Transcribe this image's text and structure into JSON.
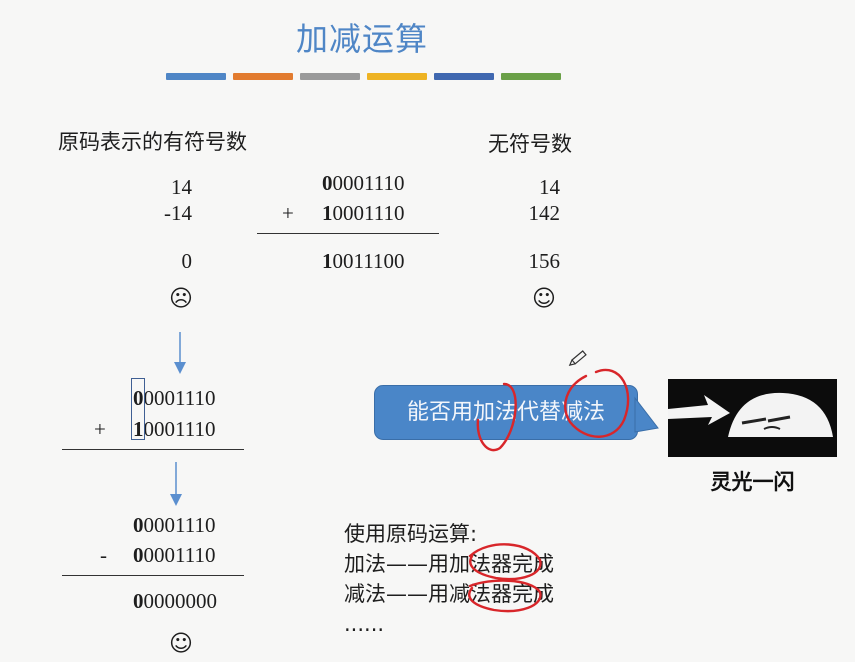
{
  "title": "加减运算",
  "bars": [
    "#4f86c6",
    "#e27b2f",
    "#9a9a9a",
    "#eeb323",
    "#4068b0",
    "#6aa047"
  ],
  "left_heading": "原码表示的有符号数",
  "right_heading": "无符号数",
  "top_example": {
    "signed": [
      "14",
      "-14",
      "0"
    ],
    "bin_a_sign": "0",
    "bin_a_rest": "0001110",
    "plus": "+",
    "bin_b_sign": "1",
    "bin_b_rest": "0001110",
    "bin_r_sign": "1",
    "bin_r_rest": "0011100",
    "unsigned": [
      "14",
      "142",
      "156"
    ],
    "sad_face": "☹",
    "happy_face": "☺"
  },
  "mid_example": {
    "a_sign": "0",
    "a_rest": "0001110",
    "plus": "+",
    "b_sign": "1",
    "b_rest": "0001110"
  },
  "bottom_example": {
    "a_sign": "0",
    "a_rest": "0001110",
    "minus": "-",
    "b_sign": "0",
    "b_rest": "0001110",
    "r_sign": "0",
    "r_rest": "0000000",
    "face": "☺"
  },
  "callout_text": "能否用加法代替减法",
  "image_caption": "灵光一闪",
  "notes": {
    "line1": "使用原码运算:",
    "line2": "加法——用加法器完成",
    "line3": "减法——用减法器完成",
    "line4": "......"
  },
  "colors": {
    "accent": "#4f86c6",
    "callout": "#4a86c8",
    "annotation": "#d8262a",
    "arrow": "#5b8fcf"
  }
}
